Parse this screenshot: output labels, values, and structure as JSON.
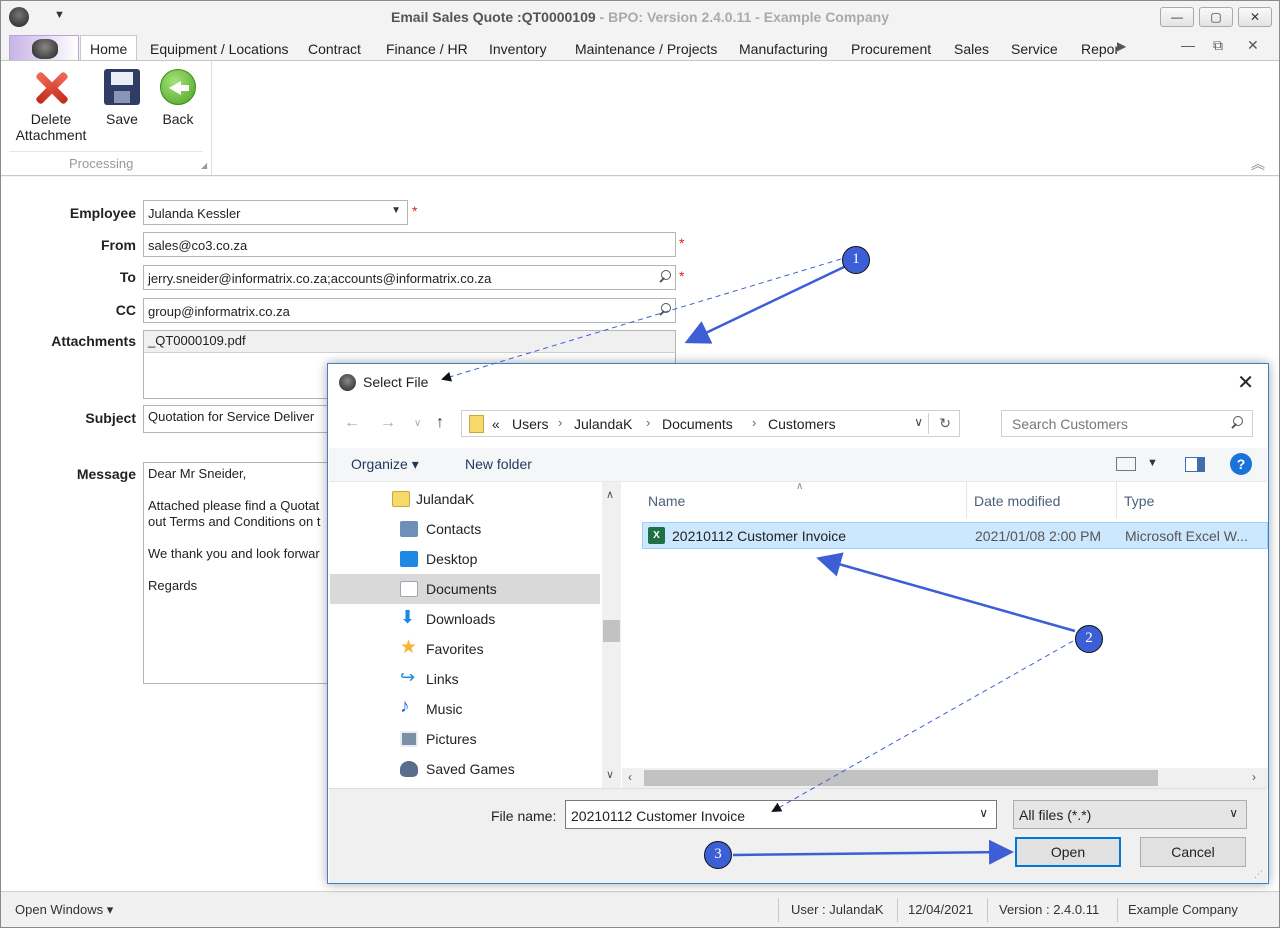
{
  "window": {
    "title_main": "Email Sales Quote :QT0000109",
    "title_suffix": " - BPO: Version 2.4.0.11 - Example Company",
    "minimize_glyph": "—",
    "maximize_glyph": "▢",
    "close_glyph": "✕"
  },
  "ribbon_tabs": [
    "Home",
    "Equipment / Locations",
    "Contract",
    "Finance / HR",
    "Inventory",
    "Maintenance / Projects",
    "Manufacturing",
    "Procurement",
    "Sales",
    "Service",
    "Repor"
  ],
  "mdi_controls": [
    "—",
    "⧉",
    "✕"
  ],
  "ribbon": {
    "delete_label_1": "Delete",
    "delete_label_2": "Attachment",
    "save_label": "Save",
    "back_label": "Back",
    "group_label": "Processing"
  },
  "form": {
    "employee_label": "Employee",
    "employee_value": "Julanda Kessler",
    "from_label": "From",
    "from_value": "sales@co3.co.za",
    "to_label": "To",
    "to_value": "jerry.sneider@informatrix.co.za;accounts@informatrix.co.za",
    "cc_label": "CC",
    "cc_value": "group@informatrix.co.za",
    "attachments_label": "Attachments",
    "attachments_value": "_QT0000109.pdf",
    "subject_label": "Subject",
    "subject_value": "Quotation for Service Deliver",
    "message_label": "Message",
    "message_lines": [
      "Dear Mr Sneider,",
      "",
      "Attached please find a Quotat",
      "out Terms and Conditions on t",
      "",
      "We thank you and look forwar",
      "",
      "Regards"
    ],
    "required_mark": "*"
  },
  "dialog": {
    "title": "Select File",
    "breadcrumb_prefix": "«",
    "breadcrumb": [
      "Users",
      "JulandaK",
      "Documents",
      "Customers"
    ],
    "search_placeholder": "Search Customers",
    "organize_label": "Organize ▾",
    "new_folder_label": "New folder",
    "nav_items": [
      {
        "label": "JulandaK",
        "icon": "folder-icon",
        "color": "#f6d96b"
      },
      {
        "label": "Contacts",
        "icon": "contacts-icon",
        "color": "#6d8fb8"
      },
      {
        "label": "Desktop",
        "icon": "desktop-icon",
        "color": "#1e88e5"
      },
      {
        "label": "Documents",
        "icon": "documents-icon",
        "color": "#9aa6b5"
      },
      {
        "label": "Downloads",
        "icon": "downloads-icon",
        "color": "#1e88e5"
      },
      {
        "label": "Favorites",
        "icon": "star-icon",
        "color": "#f2b632"
      },
      {
        "label": "Links",
        "icon": "link-icon",
        "color": "#1e88e5"
      },
      {
        "label": "Music",
        "icon": "music-icon",
        "color": "#1e6fd9"
      },
      {
        "label": "Pictures",
        "icon": "pictures-icon",
        "color": "#7b8fa8"
      },
      {
        "label": "Saved Games",
        "icon": "games-icon",
        "color": "#5a6e8c"
      }
    ],
    "selected_nav": "Documents",
    "columns": [
      "Name",
      "Date modified",
      "Type"
    ],
    "file": {
      "name": "20210112 Customer Invoice",
      "date": "2021/01/08 2:00 PM",
      "type": "Microsoft Excel W..."
    },
    "file_name_label": "File name:",
    "file_name_value": "20210112 Customer Invoice",
    "file_type_value": "All files (*.*)",
    "open_label": "Open",
    "cancel_label": "Cancel"
  },
  "status_bar": {
    "open_windows": "Open Windows ▾",
    "user": "User : JulandaK",
    "date": "12/04/2021",
    "version": "Version : 2.4.0.11",
    "company": "Example Company"
  },
  "callouts": [
    "1",
    "2",
    "3"
  ],
  "colors": {
    "callout": "#3d5fd6",
    "selection": "#cce8ff",
    "accent": "#0078d7",
    "required": "#e02020"
  }
}
